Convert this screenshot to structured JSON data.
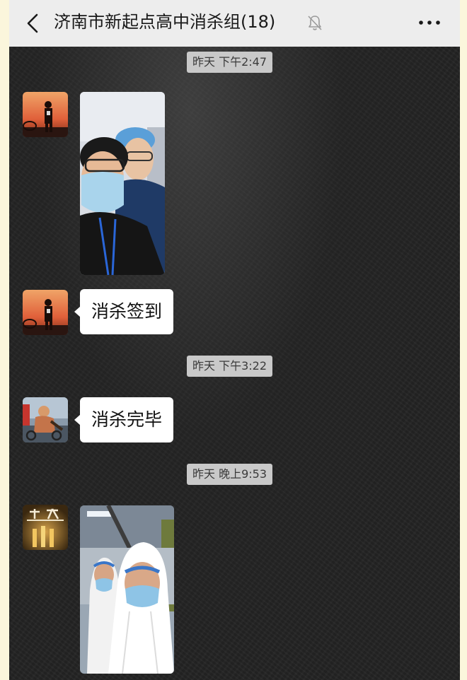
{
  "header": {
    "title": "济南市新起点高中消杀组(18)",
    "back_icon": "chevron-left-icon",
    "mute_icon": "bell-off-icon",
    "more_icon": "more-dots-icon"
  },
  "messages": [
    {
      "type": "timestamp",
      "text": "昨天 下午2:47"
    },
    {
      "type": "image",
      "sender": "member-1",
      "description_icon": "photo-two-people-masks"
    },
    {
      "type": "text",
      "sender": "member-1",
      "text": "消杀签到"
    },
    {
      "type": "timestamp",
      "text": "昨天 下午3:22"
    },
    {
      "type": "text",
      "sender": "member-2",
      "text": "消杀完毕"
    },
    {
      "type": "timestamp",
      "text": "昨天 晚上9:53"
    },
    {
      "type": "image",
      "sender": "member-3",
      "description_icon": "photo-protective-suits"
    }
  ],
  "colors": {
    "header_bg": "#ededed",
    "bubble_bg": "#ffffff",
    "timestamp_bg": "#c9c9c9",
    "chat_bg": "#232323"
  }
}
